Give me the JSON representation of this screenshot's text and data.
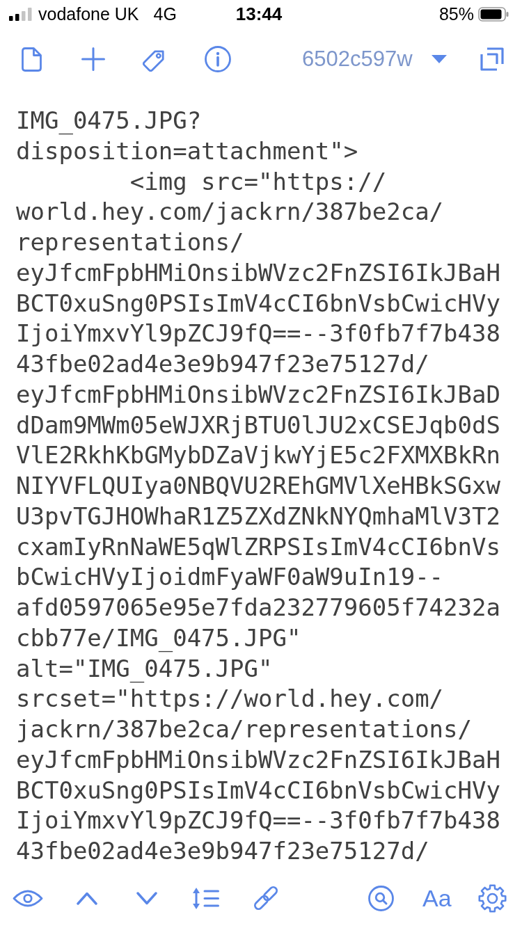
{
  "status_bar": {
    "carrier": "vodafone UK",
    "network": "4G",
    "time": "13:44",
    "battery": "85%"
  },
  "top_toolbar": {
    "title": "6502c597w"
  },
  "code_lines": [
    "IMG_0475.JPG?",
    "disposition=attachment\">",
    "        <img src=\"https://",
    "world.hey.com/jackrn/387be2ca/",
    "representations/",
    "eyJfcmFpbHMiOnsibWVzc2FnZSI6IkJBaH",
    "BCT0xuSng0PSIsImV4cCI6bnVsbCwicHVy",
    "IjoiYmxvYl9pZCJ9fQ==--3f0fb7f7b438",
    "43fbe02ad4e3e9b947f23e75127d/",
    "eyJfcmFpbHMiOnsibWVzc2FnZSI6IkJBaD",
    "dDam9MWm05eWJXRjBTU0lJU2xCSEJqb0dS",
    "VlE2RkhKbGMybDZaVjkwYjE5c2FXMXBkRn",
    "NIYVFLQUIya0NBQVU2REhGMVlXeHBkSGxw",
    "U3pvTGJHOWhaR1Z5ZXdZNkNYQmhaMlV3T2",
    "cxamIyRnNaWE5qWlZRPSIsImV4cCI6bnVs",
    "bCwicHVyIjoidmFyaWF0aW9uIn19--",
    "afd0597065e95e7fda232779605f74232a",
    "cbb77e/IMG_0475.JPG\"",
    "alt=\"IMG_0475.JPG\"",
    "srcset=\"https://world.hey.com/",
    "jackrn/387be2ca/representations/",
    "eyJfcmFpbHMiOnsibWVzc2FnZSI6IkJBaH",
    "BCT0xuSng0PSIsImV4cCI6bnVsbCwicHVy",
    "IjoiYmxvYl9pZCJ9fQ==--3f0fb7f7b438",
    "43fbe02ad4e3e9b947f23e75127d/"
  ],
  "bottom_toolbar": {
    "font_button": "Aa"
  }
}
